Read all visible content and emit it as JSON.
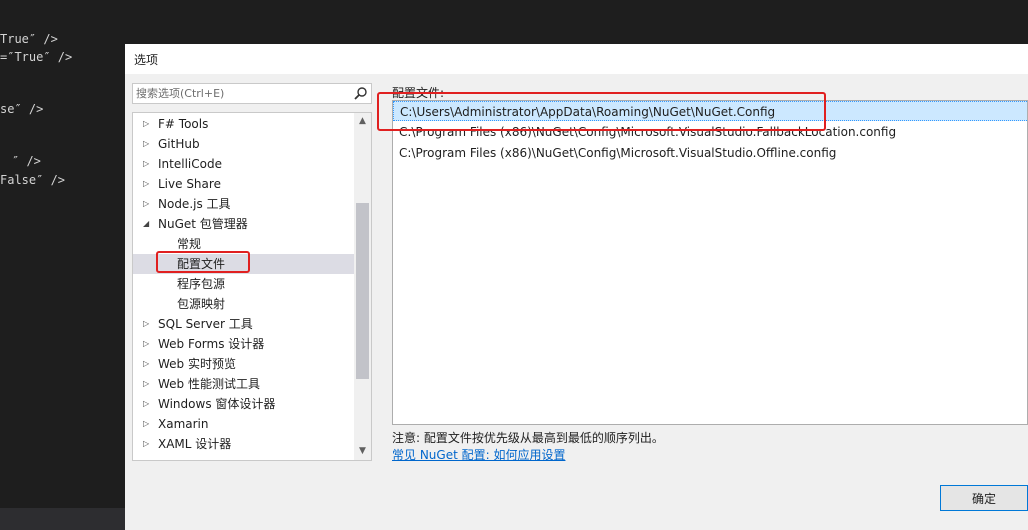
{
  "editor": {
    "lines": [
      {
        "text": "True″ />"
      },
      {
        "text": "=″True″ />"
      },
      {
        "text": "se″ />"
      },
      {
        "text": "″ />"
      },
      {
        "text": "False″ />"
      }
    ]
  },
  "dialog": {
    "title": "选项",
    "search": {
      "placeholder": "搜索选项(Ctrl+E)",
      "icon": "search-icon"
    },
    "tree": {
      "items": [
        {
          "label": "F# Tools",
          "expanded": false
        },
        {
          "label": "GitHub",
          "expanded": false
        },
        {
          "label": "IntelliCode",
          "expanded": false
        },
        {
          "label": "Live Share",
          "expanded": false
        },
        {
          "label": "Node.js 工具",
          "expanded": false
        },
        {
          "label": "NuGet 包管理器",
          "expanded": true,
          "children": [
            {
              "label": "常规"
            },
            {
              "label": "配置文件",
              "selected": true
            },
            {
              "label": "程序包源"
            },
            {
              "label": "包源映射"
            }
          ]
        },
        {
          "label": "SQL Server 工具",
          "expanded": false
        },
        {
          "label": "Web Forms 设计器",
          "expanded": false
        },
        {
          "label": "Web 实时预览",
          "expanded": false
        },
        {
          "label": "Web 性能测试工具",
          "expanded": false
        },
        {
          "label": "Windows 窗体设计器",
          "expanded": false
        },
        {
          "label": "Xamarin",
          "expanded": false
        },
        {
          "label": "XAML 设计器",
          "expanded": false
        }
      ]
    },
    "config_section": {
      "label": "配置文件:",
      "files": [
        {
          "path": "C:\\Users\\Administrator\\AppData\\Roaming\\NuGet\\NuGet.Config",
          "selected": true
        },
        {
          "path": "C:\\Program Files (x86)\\NuGet\\Config\\Microsoft.VisualStudio.FallbackLocation.config"
        },
        {
          "path": "C:\\Program Files (x86)\\NuGet\\Config\\Microsoft.VisualStudio.Offline.config"
        }
      ]
    },
    "note": "注意: 配置文件按优先级从最高到最低的顺序列出。",
    "link": "常见 NuGet 配置: 如何应用设置",
    "ok_label": "确定"
  },
  "colors": {
    "highlight": "#e02020",
    "selection": "#cce8ff",
    "link": "#0066cc",
    "editor_bg": "#1e1e1e"
  }
}
